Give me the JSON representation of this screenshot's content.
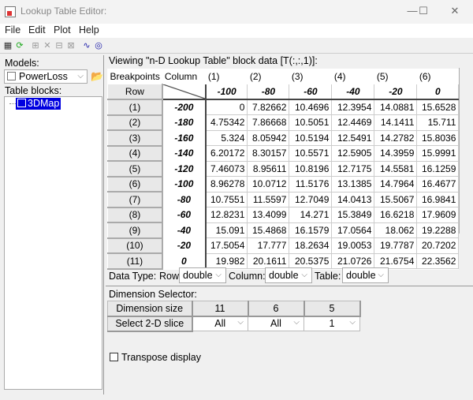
{
  "window": {
    "title": "Lookup Table Editor:",
    "minimize": "—",
    "maximize": "☐",
    "close": "✕"
  },
  "menu": [
    "File",
    "Edit",
    "Plot",
    "Help"
  ],
  "left": {
    "models_label": "Models:",
    "model": "PowerLoss",
    "table_blocks_label": "Table blocks:",
    "block": "3DMap"
  },
  "viewing": "Viewing \"n-D Lookup Table\" block data [T(:,:,1)]:",
  "grid": {
    "breakpoints_label": "Breakpoints",
    "column_label": "Column",
    "row_label": "Row",
    "col_indices": [
      "(1)",
      "(2)",
      "(3)",
      "(4)",
      "(5)",
      "(6)"
    ],
    "col_bp": [
      "-100",
      "-80",
      "-60",
      "-40",
      "-20",
      "0"
    ],
    "row_indices": [
      "(1)",
      "(2)",
      "(3)",
      "(4)",
      "(5)",
      "(6)",
      "(7)",
      "(8)",
      "(9)",
      "(10)",
      "(11)"
    ],
    "row_bp": [
      "-200",
      "-180",
      "-160",
      "-140",
      "-120",
      "-100",
      "-80",
      "-60",
      "-40",
      "-20",
      "0"
    ],
    "values": [
      [
        "0",
        "7.82662",
        "10.4696",
        "12.3954",
        "14.0881",
        "15.6528"
      ],
      [
        "4.75342",
        "7.86668",
        "10.5051",
        "12.4469",
        "14.1411",
        "15.711"
      ],
      [
        "5.324",
        "8.05942",
        "10.5194",
        "12.5491",
        "14.2782",
        "15.8036"
      ],
      [
        "6.20172",
        "8.30157",
        "10.5571",
        "12.5905",
        "14.3959",
        "15.9991"
      ],
      [
        "7.46073",
        "8.95611",
        "10.8196",
        "12.7175",
        "14.5581",
        "16.1259"
      ],
      [
        "8.96278",
        "10.0712",
        "11.5176",
        "13.1385",
        "14.7964",
        "16.4677"
      ],
      [
        "10.7551",
        "11.5597",
        "12.7049",
        "14.0413",
        "15.5067",
        "16.9841"
      ],
      [
        "12.8231",
        "13.4099",
        "14.271",
        "15.3849",
        "16.6218",
        "17.9609"
      ],
      [
        "15.091",
        "15.4868",
        "16.1579",
        "17.0564",
        "18.062",
        "19.2288"
      ],
      [
        "17.5054",
        "17.777",
        "18.2634",
        "19.0053",
        "19.7787",
        "20.7202"
      ],
      [
        "19.982",
        "20.1611",
        "20.5375",
        "21.0726",
        "21.6754",
        "22.3562"
      ]
    ]
  },
  "datatype": {
    "label": "Data Type:",
    "row_label": "Row:",
    "row": "double",
    "column_label": "Column:",
    "column": "double",
    "table_label": "Table:",
    "table": "double"
  },
  "dimension": {
    "label": "Dimension Selector:",
    "size_label": "Dimension size",
    "sizes": [
      "11",
      "6",
      "5"
    ],
    "slice_label": "Select 2-D slice",
    "slices": [
      "All",
      "All",
      "1"
    ]
  },
  "transpose": "Transpose display"
}
